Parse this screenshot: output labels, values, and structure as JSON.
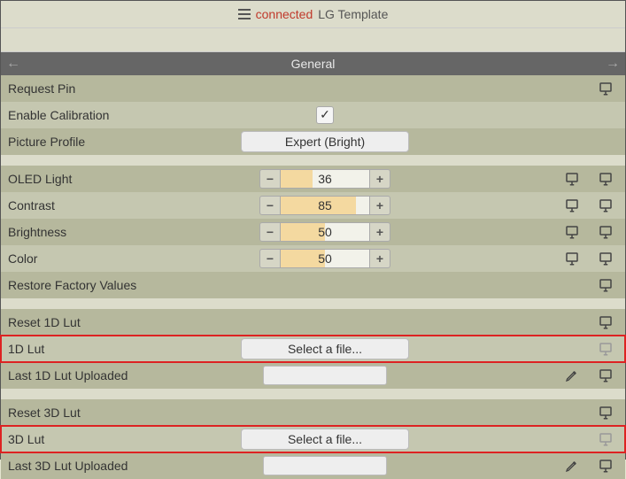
{
  "header": {
    "status": "connected",
    "title_rest": "LG Template"
  },
  "section": {
    "title": "General"
  },
  "rows": {
    "request_pin": {
      "label": "Request Pin"
    },
    "enable_calibration": {
      "label": "Enable Calibration",
      "checked": true
    },
    "picture_profile": {
      "label": "Picture Profile",
      "value": "Expert (Bright)"
    },
    "oled_light": {
      "label": "OLED Light",
      "value": 36
    },
    "contrast": {
      "label": "Contrast",
      "value": 85
    },
    "brightness": {
      "label": "Brightness",
      "value": 50
    },
    "color": {
      "label": "Color",
      "value": 50
    },
    "restore_factory": {
      "label": "Restore Factory Values"
    },
    "reset_1d_lut": {
      "label": "Reset 1D Lut"
    },
    "one_d_lut": {
      "label": "1D Lut",
      "button": "Select a file..."
    },
    "last_1d_lut_uploaded": {
      "label": "Last 1D Lut Uploaded"
    },
    "reset_3d_lut": {
      "label": "Reset 3D Lut"
    },
    "three_d_lut": {
      "label": "3D Lut",
      "button": "Select a file..."
    },
    "last_3d_lut_uploaded": {
      "label": "Last 3D Lut Uploaded"
    }
  }
}
